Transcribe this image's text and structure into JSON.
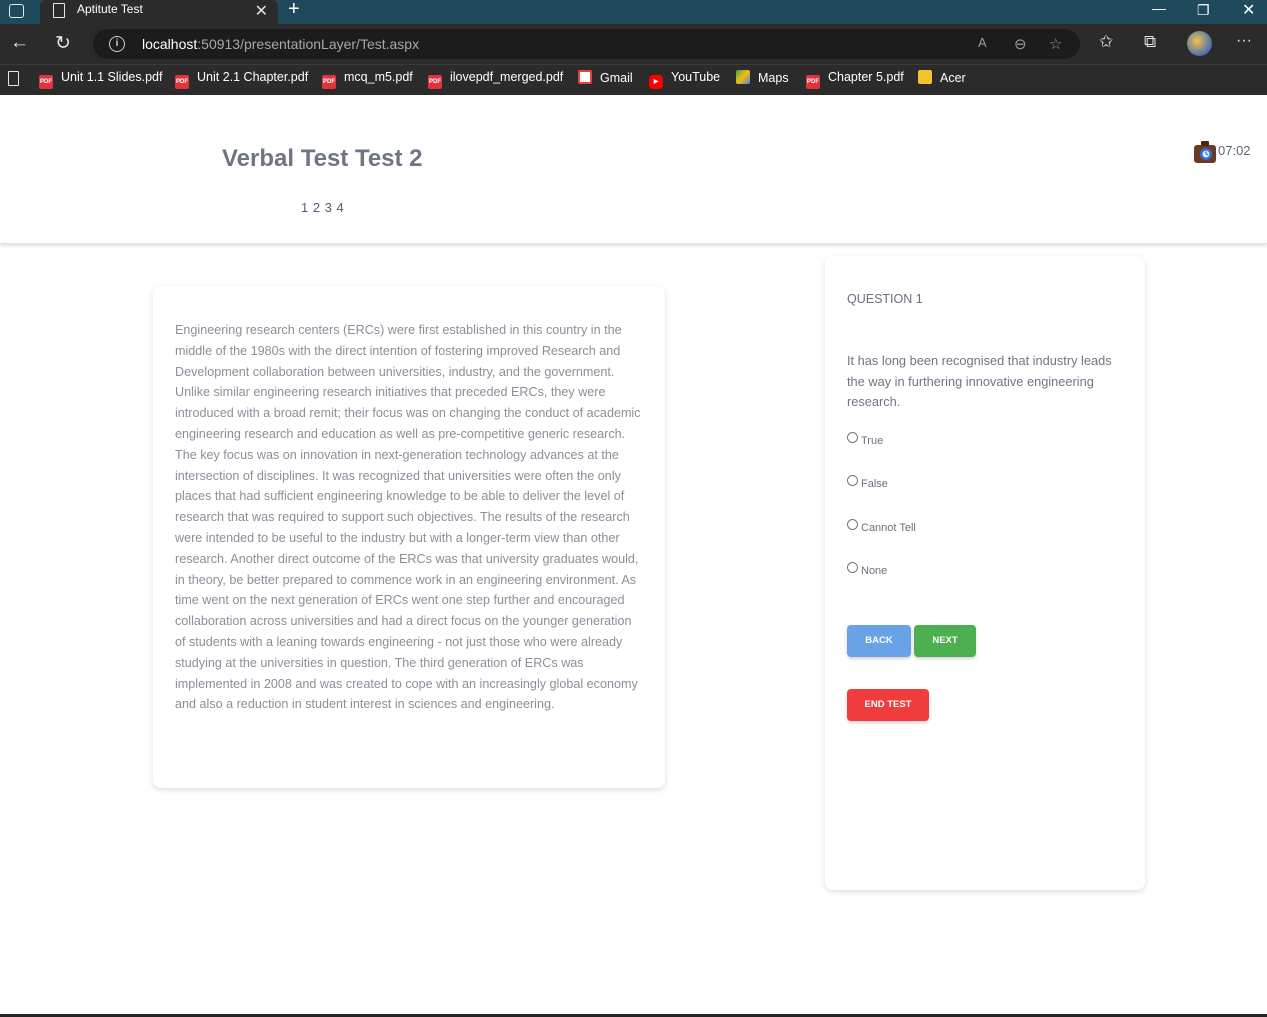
{
  "browser": {
    "tab_title": "Aptitute Test",
    "url_host": "localhost",
    "url_rest": ":50913/presentationLayer/Test.aspx",
    "bookmarks": [
      {
        "label": "Unit 1.1 Slides.pdf",
        "icon": "pdf-icon"
      },
      {
        "label": "Unit 2.1 Chapter.pdf",
        "icon": "pdf-icon"
      },
      {
        "label": "mcq_m5.pdf",
        "icon": "pdf-icon"
      },
      {
        "label": "ilovepdf_merged.pdf",
        "icon": "pdf-icon"
      },
      {
        "label": "Gmail",
        "icon": "gmail-icon"
      },
      {
        "label": "YouTube",
        "icon": "youtube-icon"
      },
      {
        "label": "Maps",
        "icon": "maps-icon"
      },
      {
        "label": "Chapter 5.pdf",
        "icon": "pdf-icon"
      },
      {
        "label": "Acer",
        "icon": "folder-icon"
      }
    ]
  },
  "header": {
    "title": "Verbal Test Test 2",
    "pages": "1 2 3 4",
    "timer": "07:02"
  },
  "passage": {
    "text": "Engineering research centers (ERCs) were first established in this country in the middle of the 1980s with the direct intention of fostering improved Research and Development collaboration between universities, industry, and the government. Unlike similar engineering research initiatives that preceded ERCs, they were introduced with a broad remit; their focus was on changing the conduct of academic engineering research and education as well as pre-competitive generic research. The key focus was on innovation in next-generation technology advances at the intersection of disciplines. It was recognized that universities were often the only places that had sufficient engineering knowledge to be able to deliver the level of research that was required to support such objectives. The results of the research were intended to be useful to the industry but with a longer-term view than other research. Another direct outcome of the ERCs was that university graduates would, in theory, be better prepared to commence work in an engineering environment. As time went on the next generation of ERCs went one step further and encouraged collaboration across universities and had a direct focus on the younger generation of students with a leaning towards engineering - not just those who were already studying at the universities in question. The third generation of ERCs was implemented in 2008 and was created to cope with an increasingly global economy and also a reduction in student interest in sciences and engineering."
  },
  "question": {
    "label": "QUESTION 1",
    "text": "It has long been recognised that industry leads the way in furthering innovative engineering research.",
    "options": [
      "True",
      "False",
      "Cannot Tell",
      "None"
    ],
    "back_label": "BACK",
    "next_label": "NEXT",
    "end_label": "END TEST"
  }
}
